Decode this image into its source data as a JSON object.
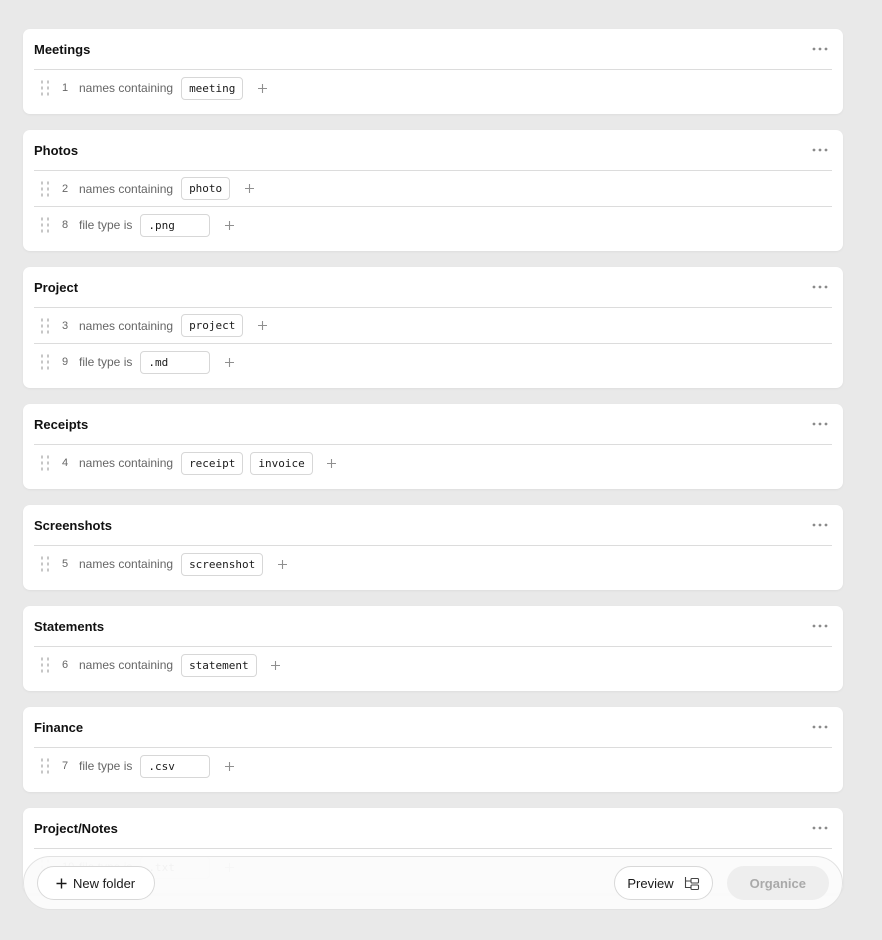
{
  "folders": [
    {
      "name": "Meetings",
      "rules": [
        {
          "num": "1",
          "kind": "names containing",
          "type": "name",
          "values": [
            "meeting"
          ]
        }
      ]
    },
    {
      "name": "Photos",
      "rules": [
        {
          "num": "2",
          "kind": "names containing",
          "type": "name",
          "values": [
            "photo"
          ]
        },
        {
          "num": "8",
          "kind": "file type is",
          "type": "ext",
          "values": [
            ".png"
          ]
        }
      ]
    },
    {
      "name": "Project",
      "rules": [
        {
          "num": "3",
          "kind": "names containing",
          "type": "name",
          "values": [
            "project"
          ]
        },
        {
          "num": "9",
          "kind": "file type is",
          "type": "ext",
          "values": [
            ".md"
          ]
        }
      ]
    },
    {
      "name": "Receipts",
      "rules": [
        {
          "num": "4",
          "kind": "names containing",
          "type": "name",
          "values": [
            "receipt",
            "invoice"
          ]
        }
      ]
    },
    {
      "name": "Screenshots",
      "rules": [
        {
          "num": "5",
          "kind": "names containing",
          "type": "name",
          "values": [
            "screenshot"
          ]
        }
      ]
    },
    {
      "name": "Statements",
      "rules": [
        {
          "num": "6",
          "kind": "names containing",
          "type": "name",
          "values": [
            "statement"
          ]
        }
      ]
    },
    {
      "name": "Finance",
      "rules": [
        {
          "num": "7",
          "kind": "file type is",
          "type": "ext",
          "values": [
            ".csv"
          ]
        }
      ]
    },
    {
      "name": "Project/Notes",
      "rules": [
        {
          "num": "10",
          "kind": "file type is",
          "type": "ext",
          "values": [
            ".txt"
          ]
        }
      ]
    }
  ],
  "toolbar": {
    "new_folder_label": "New folder",
    "preview_label": "Preview",
    "organize_label": "Organice"
  },
  "icons": {
    "more": "more-horizontal-icon",
    "drag": "drag-handle-icon",
    "add": "plus-icon",
    "tree": "folder-tree-icon"
  },
  "colors": {
    "background": "#e9e9e9",
    "card": "#ffffff",
    "organize_disabled_bg": "#eeeeee",
    "organize_disabled_text": "#a9a9a9"
  }
}
